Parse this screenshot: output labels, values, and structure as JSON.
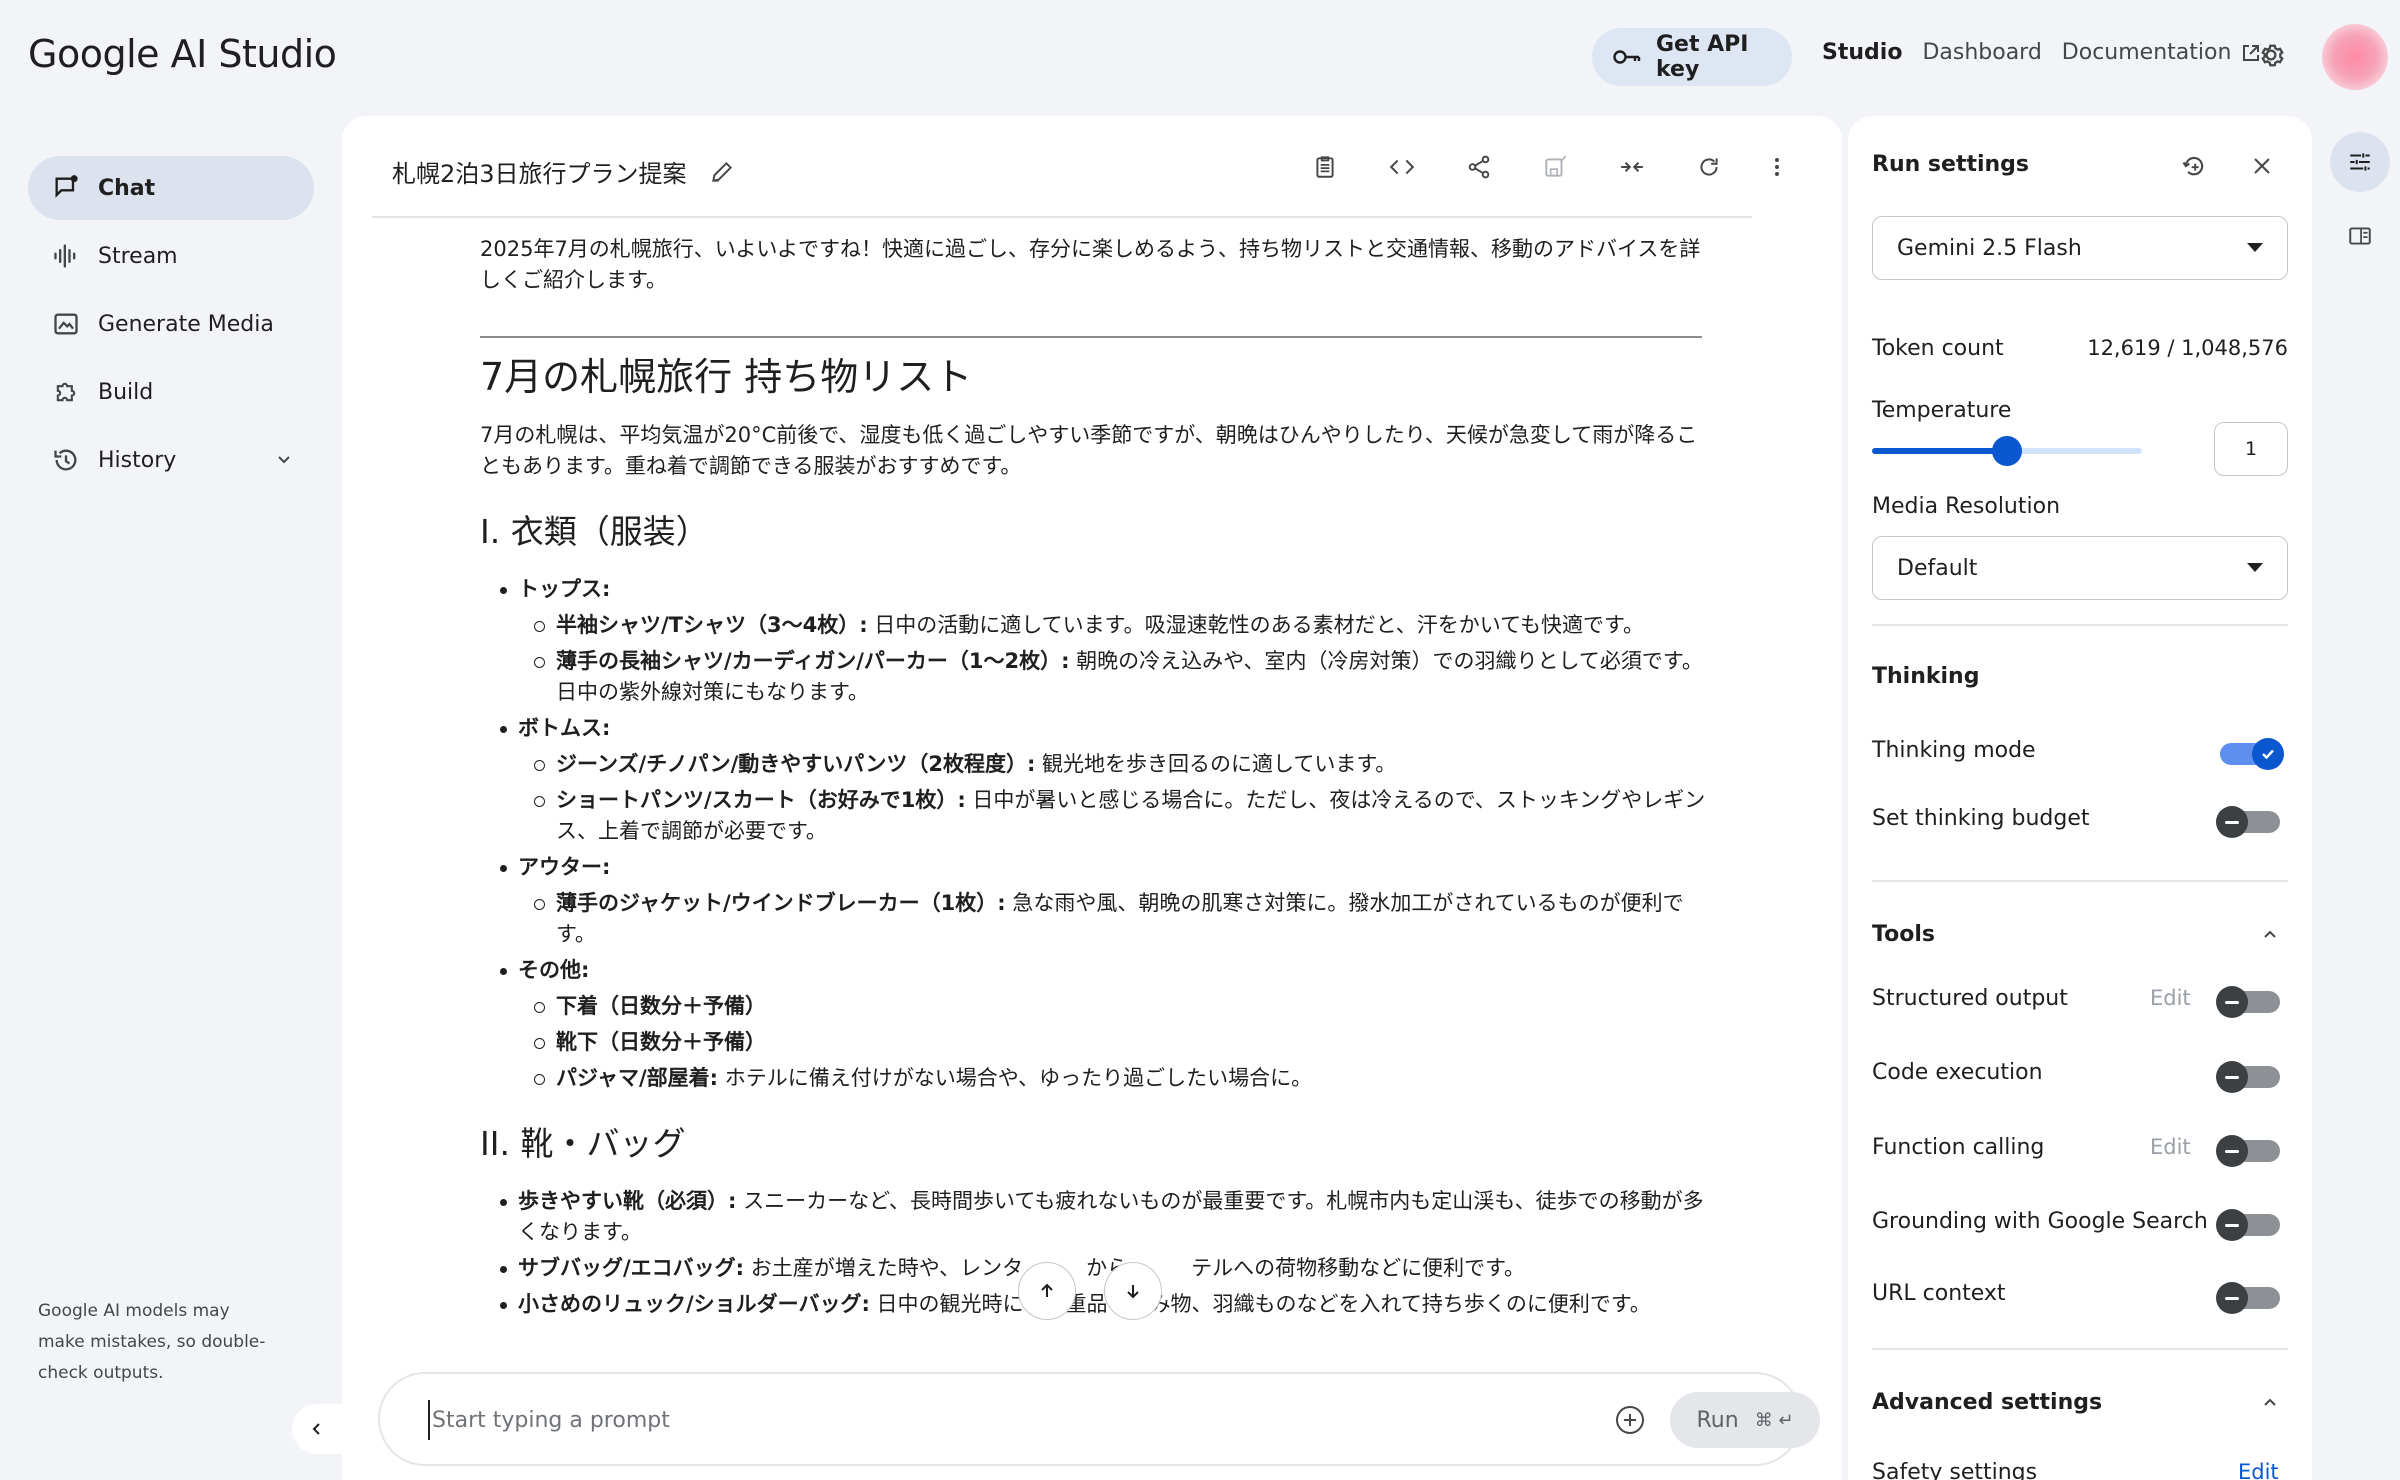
{
  "app": {
    "logo": "Google AI Studio",
    "api_key_label": "Get API key",
    "nav": {
      "studio": "Studio",
      "dashboard": "Dashboard",
      "documentation": "Documentation"
    }
  },
  "sidebar": {
    "items": [
      {
        "label": "Chat",
        "icon": "chat-icon",
        "active": true
      },
      {
        "label": "Stream",
        "icon": "waveform-icon"
      },
      {
        "label": "Generate Media",
        "icon": "image-icon"
      },
      {
        "label": "Build",
        "icon": "puzzle-icon"
      },
      {
        "label": "History",
        "icon": "history-icon"
      }
    ],
    "disclaimer": "Google AI models may make mistakes, so double-check outputs."
  },
  "chat": {
    "title": "札幌2泊3日旅行プラン提案",
    "intro": "2025年7月の札幌旅行、いよいよですね！快適に過ごし、存分に楽しめるよう、持ち物リストと交通情報、移動のアドバイスを詳しくご紹介します。",
    "h2": "7月の札幌旅行 持ち物リスト",
    "h2_desc": "7月の札幌は、平均気温が20°C前後で、湿度も低く過ごしやすい季節ですが、朝晩はひんやりしたり、天候が急変して雨が降ることもあります。重ね着で調節できる服装がおすすめです。",
    "s1_title": "I. 衣類（服装）",
    "tops_label": "トップス:",
    "tops_1_b": "半袖シャツ/Tシャツ（3〜4枚）:",
    "tops_1_t": " 日中の活動に適しています。吸湿速乾性のある素材だと、汗をかいても快適です。",
    "tops_2_b": "薄手の長袖シャツ/カーディガン/パーカー（1〜2枚）:",
    "tops_2_t": " 朝晩の冷え込みや、室内（冷房対策）での羽織りとして必須です。日中の紫外線対策にもなります。",
    "bottoms_label": "ボトムス:",
    "bottoms_1_b": "ジーンズ/チノパン/動きやすいパンツ（2枚程度）:",
    "bottoms_1_t": " 観光地を歩き回るのに適しています。",
    "bottoms_2_b": "ショートパンツ/スカート（お好みで1枚）:",
    "bottoms_2_t": " 日中が暑いと感じる場合に。ただし、夜は冷えるので、ストッキングやレギンス、上着で調節が必要です。",
    "outer_label": "アウター:",
    "outer_1_b": "薄手のジャケット/ウインドブレーカー（1枚）:",
    "outer_1_t": " 急な雨や風、朝晩の肌寒さ対策に。撥水加工がされているものが便利です。",
    "other_label": "その他:",
    "other_1_b": "下着（日数分＋予備）",
    "other_2_b": "靴下（日数分＋予備）",
    "other_3_b": "パジャマ/部屋着:",
    "other_3_t": " ホテルに備え付けがない場合や、ゆったり過ごしたい場合に。",
    "s2_title": "II. 靴・バッグ",
    "shoes_1_b": "歩きやすい靴（必須）:",
    "shoes_1_t": " スニーカーなど、長時間歩いても疲れないものが最重要です。札幌市内も定山渓も、徒歩での移動が多くなります。",
    "bag_1_b": "サブバッグ/エコバッグ:",
    "bag_1_t": " お土産が増えた時や、レンタ　　　から　　　テルへの荷物移動などに便利です。",
    "bag_2_b": "小さめのリュック/ショルダーバッグ:",
    "bag_2_t": " 日中の観光時に　　重品　　み物、羽織ものなどを入れて持ち歩くのに便利です。"
  },
  "prompt": {
    "placeholder": "Start typing a prompt",
    "run_label": "Run",
    "shortcut": "⌘ ↵"
  },
  "settings": {
    "title": "Run settings",
    "model": "Gemini 2.5 Flash",
    "token_label": "Token count",
    "token_value": "12,619 / 1,048,576",
    "temperature_label": "Temperature",
    "temperature_value": "1",
    "temperature_fraction": 0.5,
    "media_label": "Media Resolution",
    "media_value": "Default",
    "thinking_title": "Thinking",
    "thinking_mode": {
      "label": "Thinking mode",
      "on": true
    },
    "thinking_budget": {
      "label": "Set thinking budget",
      "on": false
    },
    "tools_title": "Tools",
    "tools": [
      {
        "label": "Structured output",
        "edit": "Edit",
        "on": false
      },
      {
        "label": "Code execution",
        "on": false
      },
      {
        "label": "Function calling",
        "edit": "Edit",
        "on": false
      },
      {
        "label": "Grounding with Google Search",
        "on": false
      },
      {
        "label": "URL context",
        "on": false
      }
    ],
    "advanced_title": "Advanced settings",
    "safety_label": "Safety settings",
    "safety_edit": "Edit"
  },
  "colors": {
    "accent": "#0b57d0",
    "background": "#f2f4f8",
    "panel": "#ffffff"
  }
}
